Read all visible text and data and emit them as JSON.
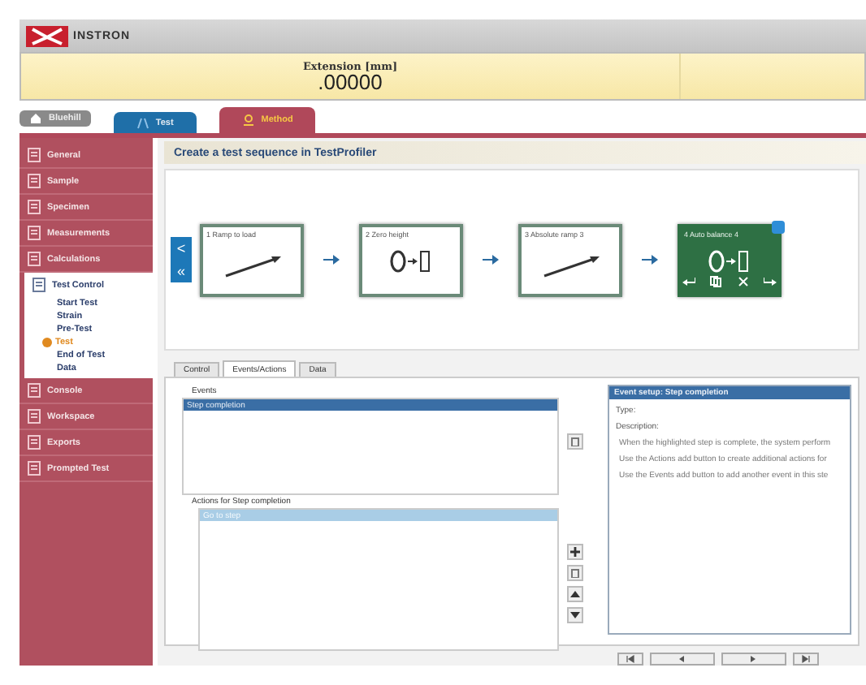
{
  "app": {
    "brand": "INSTRON"
  },
  "readout": {
    "label": "Extension [mm]",
    "value": ".00000"
  },
  "tabs": [
    {
      "label": "Bluehill",
      "kind": "home",
      "color": "#8a8a8a",
      "selected": false
    },
    {
      "label": "Test",
      "kind": "test",
      "color": "#1f6fa8",
      "selected": false
    },
    {
      "label": "Method",
      "kind": "method",
      "color": "#b0485a",
      "selected": true
    }
  ],
  "sidebar": {
    "items": [
      {
        "label": "General",
        "expanded": false
      },
      {
        "label": "Sample",
        "expanded": false
      },
      {
        "label": "Specimen",
        "expanded": false
      },
      {
        "label": "Measurements",
        "expanded": false
      },
      {
        "label": "Calculations",
        "expanded": false
      },
      {
        "label": "Test Control",
        "expanded": true,
        "children": [
          {
            "label": "Start Test",
            "selected": false
          },
          {
            "label": "Strain",
            "selected": false
          },
          {
            "label": "Pre-Test",
            "selected": false
          },
          {
            "label": "Test",
            "selected": true
          },
          {
            "label": "End of Test",
            "selected": false
          },
          {
            "label": "Data",
            "selected": false
          }
        ]
      },
      {
        "label": "Console",
        "expanded": false
      },
      {
        "label": "Workspace",
        "expanded": false
      },
      {
        "label": "Exports",
        "expanded": false
      },
      {
        "label": "Prompted Test",
        "expanded": false
      }
    ]
  },
  "page_title": "Create a test sequence in TestProfiler",
  "sequence_nav": [
    "<",
    "«"
  ],
  "steps": [
    {
      "label": "1 Ramp to load",
      "kind": "ramp",
      "selected": false
    },
    {
      "label": "2 Zero height",
      "kind": "zero",
      "selected": false
    },
    {
      "label": "3 Absolute ramp 3",
      "kind": "ramp",
      "selected": false
    },
    {
      "label": "4 Auto balance 4",
      "kind": "zero",
      "selected": true
    }
  ],
  "detail_tabs": [
    {
      "label": "Control",
      "selected": false
    },
    {
      "label": "Events/Actions",
      "selected": true
    },
    {
      "label": "Data",
      "selected": false
    }
  ],
  "events": {
    "label": "Events",
    "items": [
      {
        "label": "Step completion",
        "selected": true
      }
    ]
  },
  "actions": {
    "label": "Actions for Step completion",
    "items": [
      {
        "label": "Go to step",
        "selected": true
      }
    ]
  },
  "event_setup": {
    "title": "Event setup: Step completion",
    "type_label": "Type:",
    "description_label": "Description:",
    "lines": [
      "When the highlighted step is complete, the system perform",
      "Use the Actions add button to create additional actions for",
      "Use the Events add button to add another event in this ste"
    ]
  }
}
